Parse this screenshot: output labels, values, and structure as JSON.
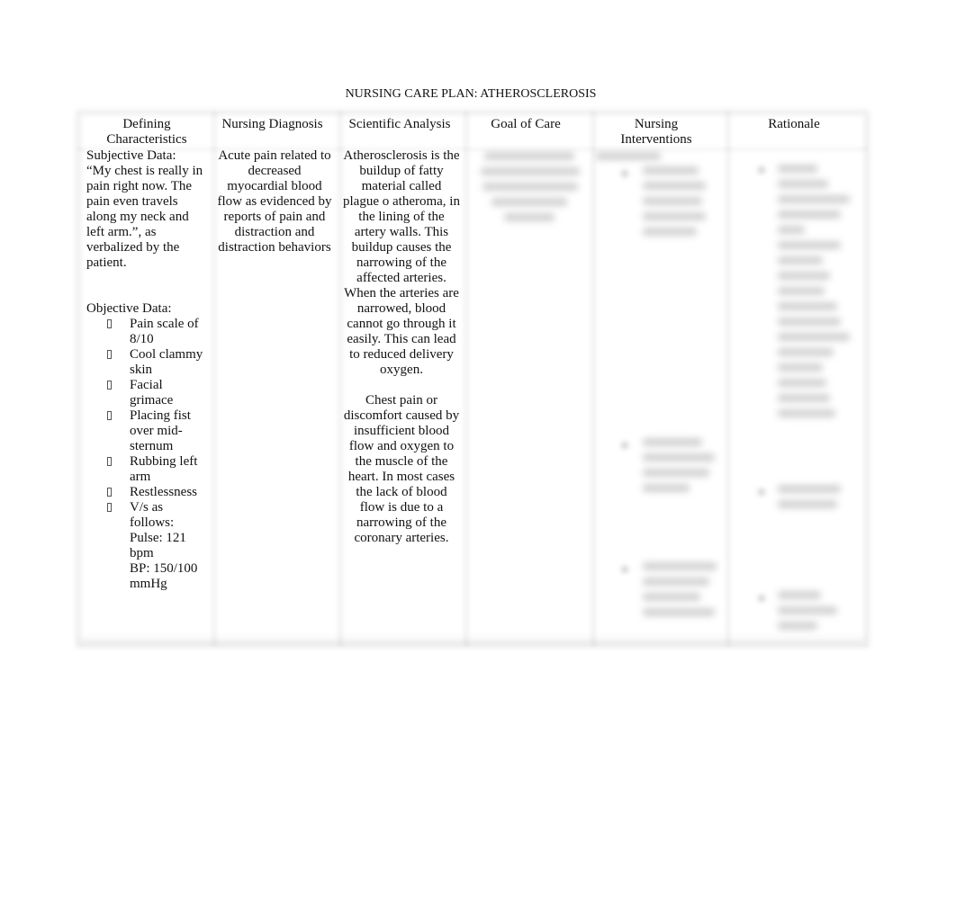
{
  "document": {
    "title": "NURSING CARE PLAN: ATHEROSCLEROSIS"
  },
  "table": {
    "headers": [
      "Defining Characteristics",
      "Nursing Diagnosis",
      "Scientific Analysis",
      "Goal of Care",
      "Nursing Interventions",
      "Rationale"
    ],
    "defining_characteristics": {
      "subjective_label": "Subjective Data:",
      "subjective_text": "“My chest is really in pain right now. The pain even travels along my neck and left arm.”, as verbalized by the patient.",
      "objective_label": "Objective Data:",
      "bullet_icon": "missing-glyph-box",
      "objective_items": [
        "Pain scale of 8/10",
        "Cool clammy skin",
        "Facial grimace",
        "Placing fist over mid-sternum",
        "Rubbing left arm",
        "Restlessness",
        "V/s as follows:"
      ],
      "vitals": [
        "Pulse: 121 bpm",
        "BP: 150/100 mmHg"
      ]
    },
    "nursing_diagnosis": "Acute pain related to decreased myocardial blood flow as evidenced by reports of pain and distraction and distraction behaviors",
    "scientific_analysis": [
      "Atherosclerosis is the buildup of fatty material called plague o atheroma, in the lining of the artery walls. This buildup causes the narrowing of the affected arteries. When the arteries are narrowed, blood cannot go through it easily. This can lead to reduced delivery oxygen.",
      "Chest pain or discomfort caused by insufficient blood flow and oxygen to the muscle of the heart. In most cases the lack of blood flow is due to a narrowing of the coronary arteries."
    ],
    "goal_of_care": "[blurred content]",
    "nursing_interventions": "[blurred content]",
    "rationale": "[blurred content]"
  }
}
